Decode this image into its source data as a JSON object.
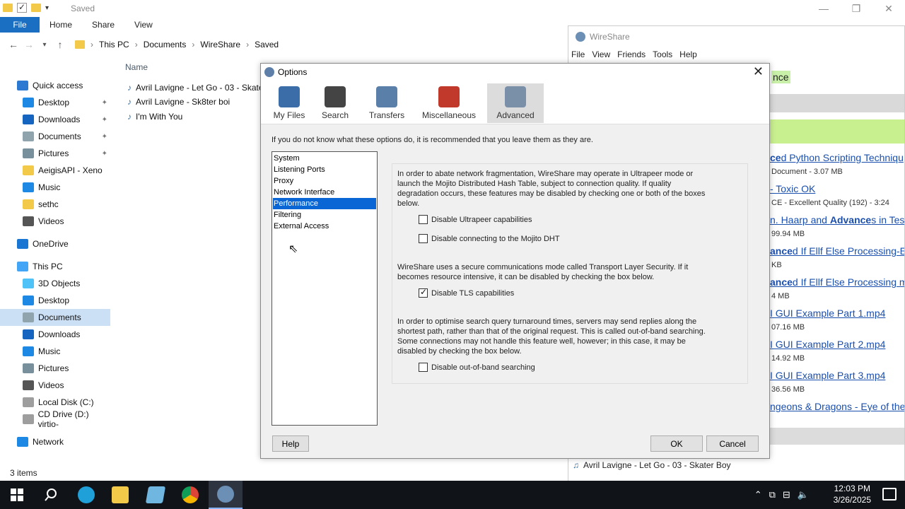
{
  "explorer": {
    "title": "Saved",
    "ribbon_tabs": [
      "File",
      "Home",
      "Share",
      "View"
    ],
    "breadcrumb": [
      "This PC",
      "Documents",
      "WireShare",
      "Saved"
    ],
    "nav_items": [
      {
        "label": "Quick access",
        "icon": "star-icon",
        "color": "#2b79d0"
      },
      {
        "label": "Desktop",
        "icon": "desktop-icon",
        "color": "#1e88e5",
        "pinned": true
      },
      {
        "label": "Downloads",
        "icon": "download-icon",
        "color": "#1565c0",
        "pinned": true
      },
      {
        "label": "Documents",
        "icon": "document-icon",
        "color": "#90a4ae",
        "pinned": true
      },
      {
        "label": "Pictures",
        "icon": "pictures-icon",
        "color": "#78909c",
        "pinned": true
      },
      {
        "label": "AeigisAPI - Xeno",
        "icon": "folder-icon",
        "color": "#f3c94a"
      },
      {
        "label": "Music",
        "icon": "music-icon",
        "color": "#1e88e5"
      },
      {
        "label": "sethc",
        "icon": "folder-icon",
        "color": "#f3c94a"
      },
      {
        "label": "Videos",
        "icon": "video-icon",
        "color": "#555555"
      },
      {
        "label": "OneDrive",
        "icon": "cloud-icon",
        "color": "#1976d2"
      },
      {
        "label": "This PC",
        "icon": "pc-icon",
        "color": "#42a5f5"
      },
      {
        "label": "3D Objects",
        "icon": "cube-icon",
        "color": "#4fc3f7"
      },
      {
        "label": "Desktop",
        "icon": "desktop-icon",
        "color": "#1e88e5"
      },
      {
        "label": "Documents",
        "icon": "document-icon",
        "color": "#90a4ae",
        "selected": true
      },
      {
        "label": "Downloads",
        "icon": "download-icon",
        "color": "#1565c0"
      },
      {
        "label": "Music",
        "icon": "music-icon",
        "color": "#1e88e5"
      },
      {
        "label": "Pictures",
        "icon": "pictures-icon",
        "color": "#78909c"
      },
      {
        "label": "Videos",
        "icon": "video-icon",
        "color": "#555555"
      },
      {
        "label": "Local Disk (C:)",
        "icon": "disk-icon",
        "color": "#9e9e9e"
      },
      {
        "label": "CD Drive (D:) virtio-",
        "icon": "cd-icon",
        "color": "#9e9e9e"
      },
      {
        "label": "Network",
        "icon": "network-icon",
        "color": "#1e88e5"
      }
    ],
    "column_header": "Name",
    "files": [
      "Avril Lavigne - Let Go - 03 - Skate",
      "Avril Lavigne - Sk8ter boi",
      "I'm With You"
    ],
    "status": "3 items"
  },
  "wireshare": {
    "title": "WireShare",
    "menu": [
      "File",
      "View",
      "Friends",
      "Tools",
      "Help"
    ],
    "search_fragment": "nce",
    "results": [
      {
        "pre": "",
        "bold": "ce",
        "post": "d Python Scripting Techniqu",
        "sub": "Document - 3.07 MB"
      },
      {
        "pre": "",
        "bold": "",
        "post": "- Toxic OK",
        "sub": "CE - Excellent Quality (192) - 3:24"
      },
      {
        "pre": "n. Haarp and ",
        "bold": "Advance",
        "post": "s in Tes",
        "sub": "99.94 MB"
      },
      {
        "pre": "",
        "bold": "ance",
        "post": "d If Ellf Else Processing-E",
        "sub": "KB"
      },
      {
        "pre": "",
        "bold": "ance",
        "post": "d If Ellf Else Processing m",
        "sub": "4 MB"
      },
      {
        "pre": "",
        "bold": "",
        "post": "I GUI Example Part 1.mp4",
        "sub": "07.16 MB"
      },
      {
        "pre": "",
        "bold": "",
        "post": "I GUI Example Part 2.mp4",
        "sub": "14.92 MB"
      },
      {
        "pre": "",
        "bold": "",
        "post": "I GUI Example Part 3.mp4",
        "sub": "36.56 MB"
      },
      {
        "pre": "",
        "bold": "",
        "post": "ngeons & Dragons - Eye of the",
        "sub": ""
      }
    ],
    "now_playing": "Avril Lavigne - Let Go - 03 - Skater Boy"
  },
  "options": {
    "title": "Options",
    "tabs": [
      {
        "label": "My Files",
        "icon": "my-files-icon",
        "color": "#3b6ea8"
      },
      {
        "label": "Search",
        "icon": "binoculars-icon",
        "color": "#444444"
      },
      {
        "label": "Transfers",
        "icon": "transfers-icon",
        "color": "#5a7fa8"
      },
      {
        "label": "Miscellaneous",
        "icon": "tools-icon",
        "color": "#c0392b"
      },
      {
        "label": "Advanced",
        "icon": "advanced-gear-icon",
        "color": "#7a8fa8",
        "active": true
      }
    ],
    "info": "If you do not know what these options do, it is recommended that you leave them as they are.",
    "categories": [
      "System",
      "Listening Ports",
      "Proxy",
      "Network Interface",
      "Performance",
      "Filtering",
      "External Access"
    ],
    "selected_category": "Performance",
    "para1": "In order to abate network fragmentation, WireShare may operate in Ultrapeer mode or launch the Mojito Distributed Hash Table, subject to connection quality.  If quality degradation occurs, these features may be disabled by checking one or both of the boxes below.",
    "chk1": {
      "label": "Disable Ultrapeer capabilities",
      "checked": false
    },
    "chk2": {
      "label": "Disable connecting to the Mojito DHT",
      "checked": false
    },
    "para2": "WireShare uses a secure communications mode called Transport Layer Security.  If it becomes resource intensive, it can be disabled by checking the box below.",
    "chk3": {
      "label": "Disable TLS capabilities",
      "checked": true
    },
    "para3": "In order to optimise search query turnaround times, servers may send replies along the shortest path, rather than that of the original request.  This is called out-of-band searching.  Some connections may not handle this feature well, however; in this case, it may be disabled by checking the box below.",
    "chk4": {
      "label": "Disable out-of-band searching",
      "checked": false
    },
    "help": "Help",
    "ok": "OK",
    "cancel": "Cancel"
  },
  "taskbar": {
    "time": "12:03 PM",
    "date": "3/26/2025"
  }
}
